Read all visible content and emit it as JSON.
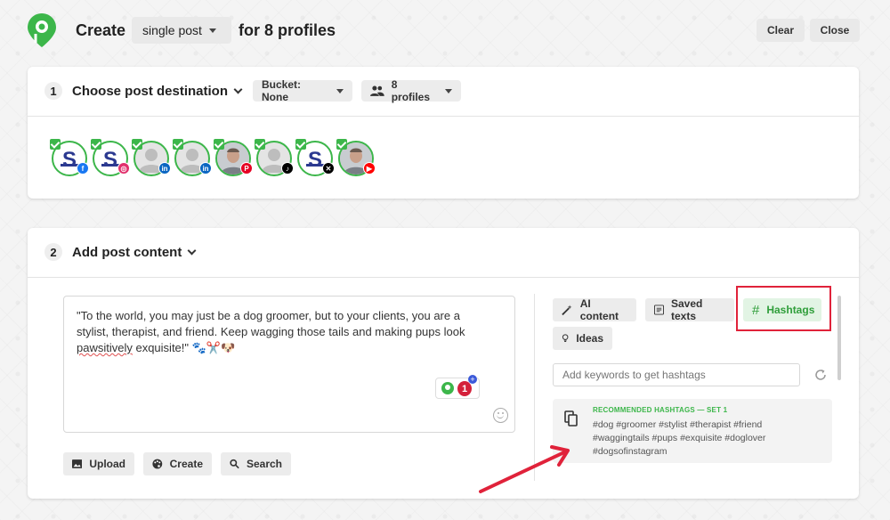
{
  "header": {
    "create_label": "Create",
    "post_type": "single post",
    "for_label": "for 8 profiles",
    "clear_label": "Clear",
    "close_label": "Close"
  },
  "step1": {
    "number": "1",
    "title": "Choose post destination",
    "bucket_label": "Bucket: None",
    "profiles_label": "8 profiles",
    "profiles": [
      {
        "network": "Facebook",
        "avatar": "brand-logo",
        "badge_color": "#1877f2"
      },
      {
        "network": "Instagram",
        "avatar": "brand-logo",
        "badge_color": "#e1306c"
      },
      {
        "network": "LinkedIn",
        "avatar": "default-person",
        "badge_color": "#0a66c2"
      },
      {
        "network": "LinkedIn",
        "avatar": "default-person",
        "badge_color": "#0a66c2"
      },
      {
        "network": "Pinterest",
        "avatar": "photo",
        "badge_color": "#e60023"
      },
      {
        "network": "TikTok",
        "avatar": "default-person",
        "badge_color": "#000000"
      },
      {
        "network": "X",
        "avatar": "brand-logo",
        "badge_color": "#000000"
      },
      {
        "network": "YouTube",
        "avatar": "photo",
        "badge_color": "#ff0000"
      }
    ]
  },
  "step2": {
    "number": "2",
    "title": "Add post content",
    "post_text_line1": "\"To the world, you may just be a dog groomer, but to your clients, you are a",
    "post_text_line2": "stylist, therapist, and friend. Keep wagging those tails and making pups look",
    "post_text_misspelled": "pawsitively",
    "post_text_rest": " exquisite!\" 🐾✂️🐶",
    "counter_badge": "1",
    "upload_label": "Upload",
    "create_label": "Create",
    "search_label": "Search"
  },
  "panel": {
    "ai_content_label": "AI content",
    "saved_texts_label": "Saved texts",
    "hashtags_label": "Hashtags",
    "ideas_label": "Ideas",
    "keyword_placeholder": "Add keywords to get hashtags",
    "recommended_title": "RECOMMENDED HASHTAGS — SET 1",
    "hashtags_line1": "#dog #groomer #stylist #therapist #friend",
    "hashtags_line2": "#waggingtails #pups #exquisite #doglover",
    "hashtags_line3": "#dogsofinstagram"
  },
  "colors": {
    "brand_green": "#3cb64a",
    "annotation_red": "#e0223a"
  }
}
